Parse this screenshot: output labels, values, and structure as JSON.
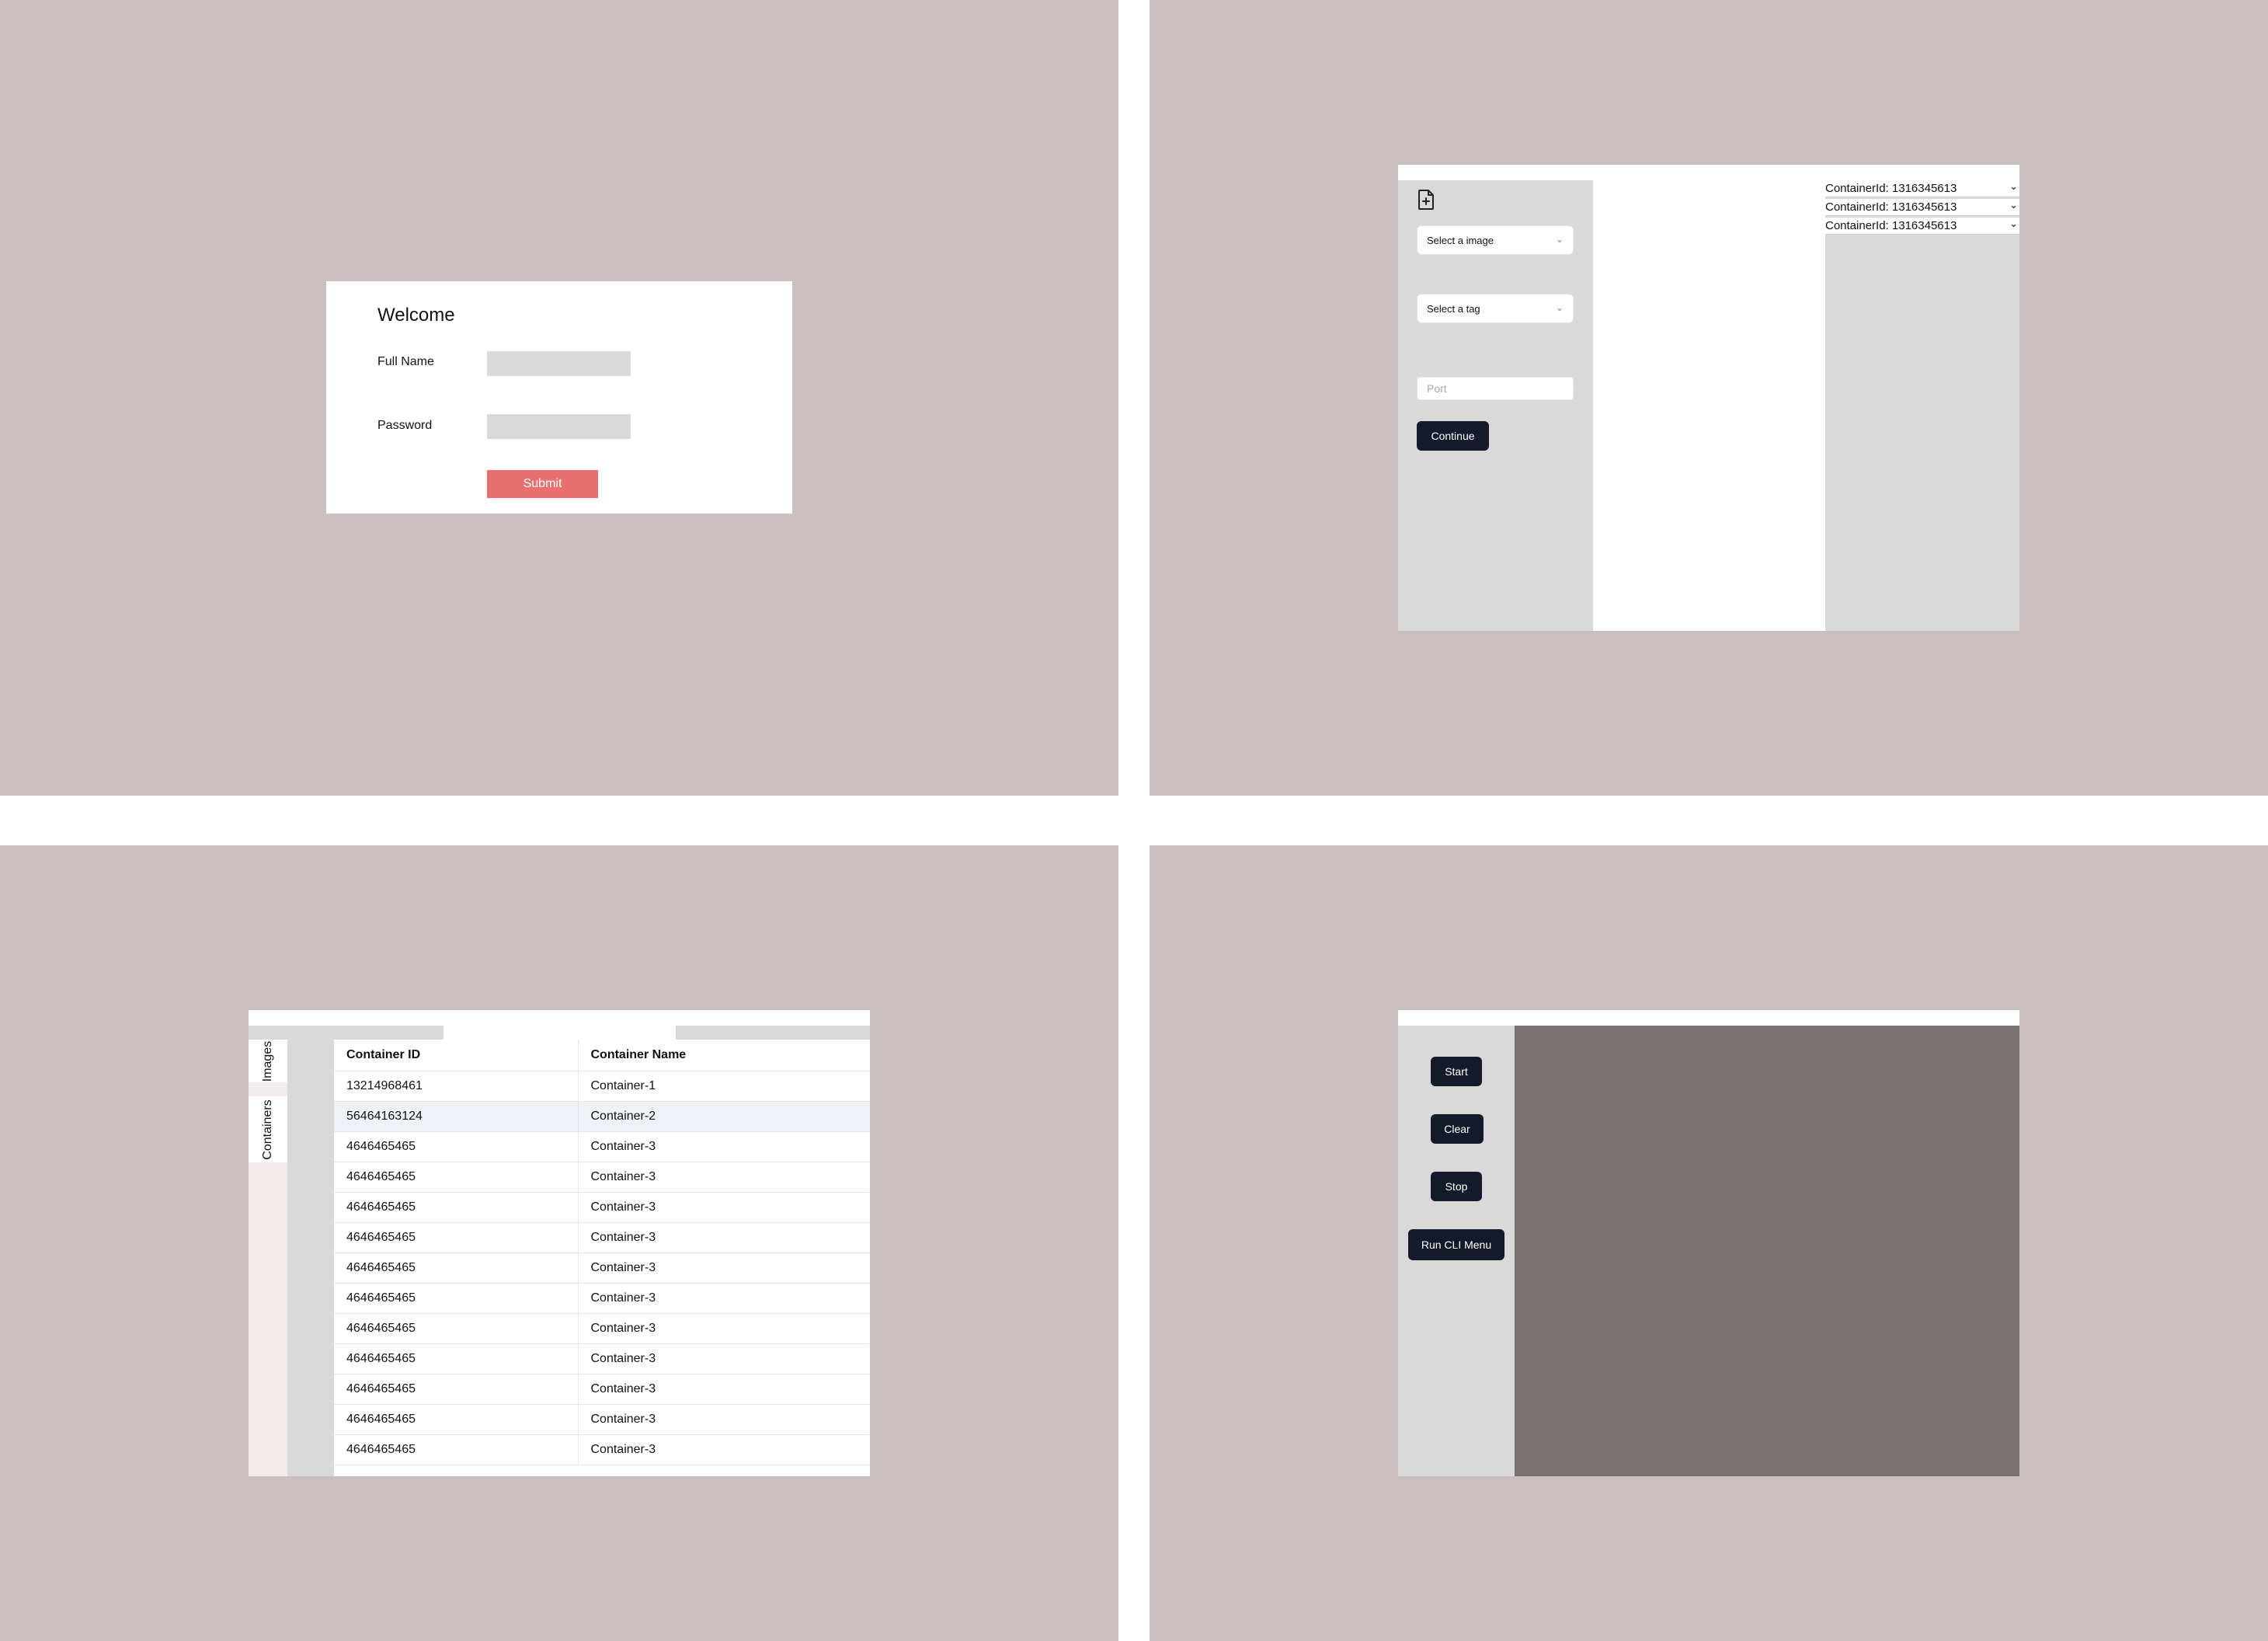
{
  "login": {
    "title": "Welcome",
    "fullname_label": "Full Name",
    "password_label": "Password",
    "submit_label": "Submit",
    "submit_color": "#e87070"
  },
  "create": {
    "icon": "file-add-icon",
    "image_select_placeholder": "Select a image",
    "tag_select_placeholder": "Select a tag",
    "port_placeholder": "Port",
    "continue_label": "Continue",
    "container_ids": [
      "ContainerId: 1316345613",
      "ContainerId: 1316345613",
      "ContainerId: 1316345613"
    ]
  },
  "containers": {
    "tabs": [
      "Images",
      "Containers"
    ],
    "columns": [
      "Container ID",
      "Container Name"
    ],
    "rows": [
      [
        "13214968461",
        "Container-1"
      ],
      [
        "56464163124",
        "Container-2"
      ],
      [
        "4646465465",
        "Container-3"
      ],
      [
        "4646465465",
        "Container-3"
      ],
      [
        "4646465465",
        "Container-3"
      ],
      [
        "4646465465",
        "Container-3"
      ],
      [
        "4646465465",
        "Container-3"
      ],
      [
        "4646465465",
        "Container-3"
      ],
      [
        "4646465465",
        "Container-3"
      ],
      [
        "4646465465",
        "Container-3"
      ],
      [
        "4646465465",
        "Container-3"
      ],
      [
        "4646465465",
        "Container-3"
      ],
      [
        "4646465465",
        "Container-3"
      ]
    ]
  },
  "controls": {
    "start_label": "Start",
    "clear_label": "Clear",
    "stop_label": "Stop",
    "cli_label": "Run CLI Menu",
    "button_color": "#141a2b",
    "terminal_color": "#777170"
  }
}
